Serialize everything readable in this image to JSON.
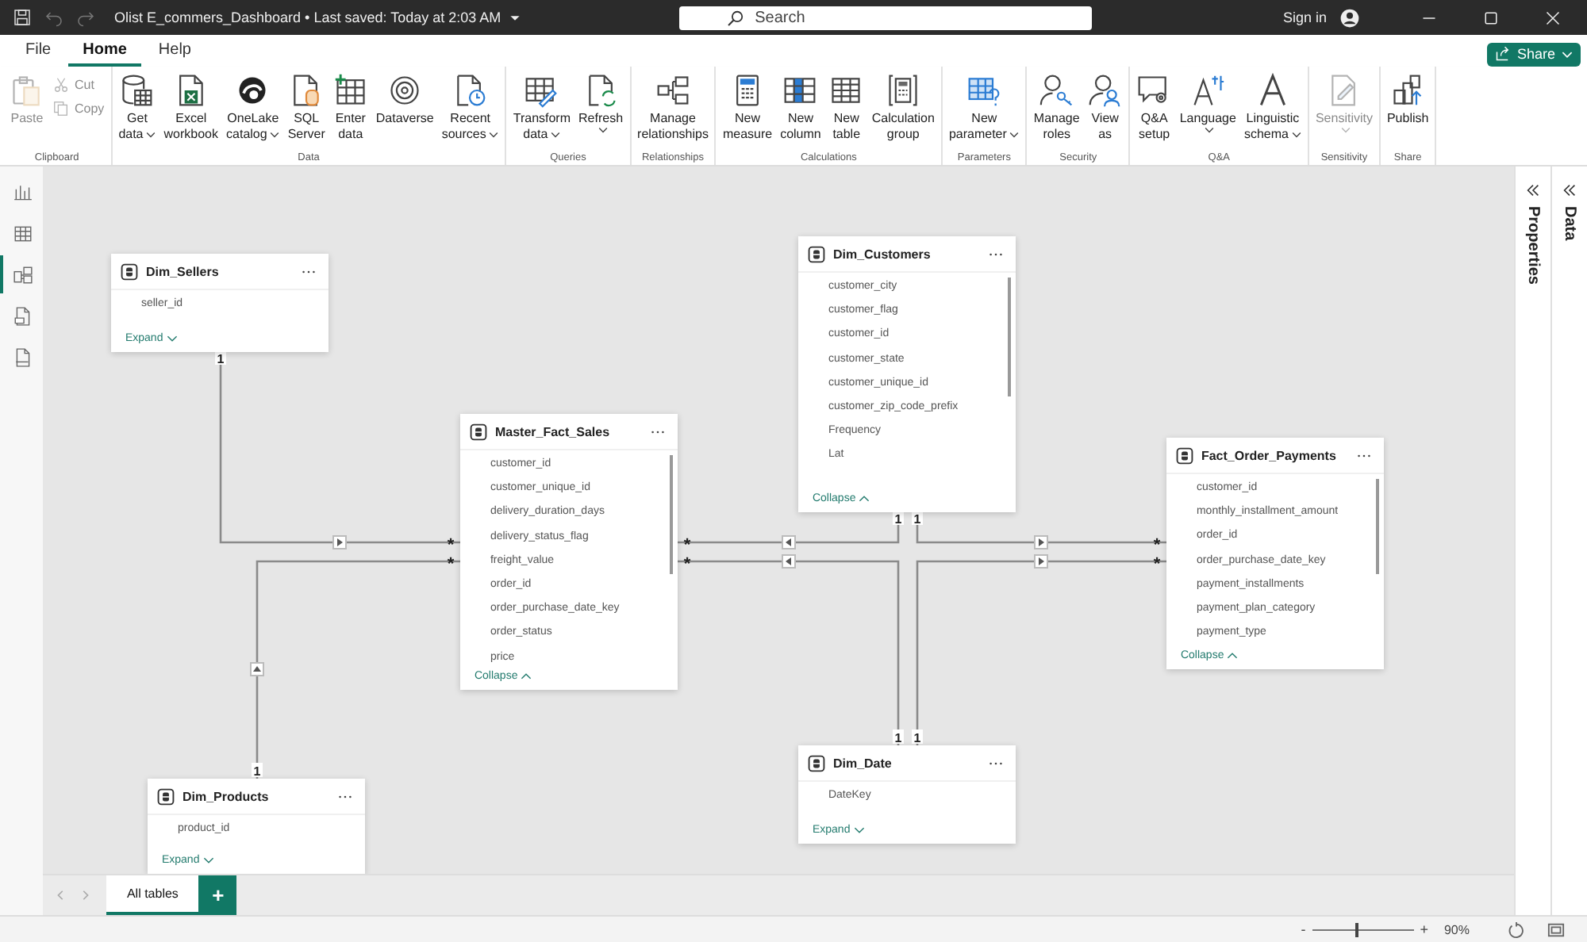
{
  "title_bar": {
    "document": "Olist E_commers_Dashboard • Last saved: Today at 2:03 AM",
    "search_placeholder": "Search",
    "sign_in": "Sign in"
  },
  "ribbon_tabs": [
    {
      "label": "File",
      "selected": false
    },
    {
      "label": "Home",
      "selected": true
    },
    {
      "label": "Help",
      "selected": false
    }
  ],
  "share": "Share",
  "ribbon_groups": [
    {
      "label": "Clipboard",
      "buttons": [
        {
          "kind": "large",
          "lines": [
            "Paste"
          ],
          "dropdown": false,
          "disabled": true
        },
        {
          "kind": "small",
          "lines": [
            "Cut"
          ],
          "disabled": true
        },
        {
          "kind": "small",
          "lines": [
            "Copy"
          ],
          "disabled": true
        }
      ]
    },
    {
      "label": "Data",
      "buttons": [
        {
          "kind": "large",
          "lines": [
            "Get",
            "data"
          ],
          "dropdown": true,
          "disabled": false
        },
        {
          "kind": "large",
          "lines": [
            "Excel",
            "workbook"
          ],
          "dropdown": false,
          "disabled": false
        },
        {
          "kind": "large",
          "lines": [
            "OneLake",
            "catalog"
          ],
          "dropdown": true,
          "disabled": false
        },
        {
          "kind": "large",
          "lines": [
            "SQL",
            "Server"
          ],
          "dropdown": false,
          "disabled": false
        },
        {
          "kind": "large",
          "lines": [
            "Enter",
            "data"
          ],
          "dropdown": false,
          "disabled": false
        },
        {
          "kind": "large",
          "lines": [
            "Dataverse"
          ],
          "dropdown": false,
          "disabled": false
        },
        {
          "kind": "large",
          "lines": [
            "Recent",
            "sources"
          ],
          "dropdown": true,
          "disabled": false
        }
      ]
    },
    {
      "label": "Queries",
      "buttons": [
        {
          "kind": "large",
          "lines": [
            "Transform",
            "data"
          ],
          "dropdown": true,
          "disabled": false
        },
        {
          "kind": "large",
          "lines": [
            "Refresh"
          ],
          "dropdown": true,
          "disabled": false
        }
      ]
    },
    {
      "label": "Relationships",
      "buttons": [
        {
          "kind": "large",
          "lines": [
            "Manage",
            "relationships"
          ],
          "dropdown": false,
          "disabled": false
        }
      ]
    },
    {
      "label": "Calculations",
      "buttons": [
        {
          "kind": "large",
          "lines": [
            "New",
            "measure"
          ],
          "dropdown": false,
          "disabled": false
        },
        {
          "kind": "large",
          "lines": [
            "New",
            "column"
          ],
          "dropdown": false,
          "disabled": false
        },
        {
          "kind": "large",
          "lines": [
            "New",
            "table"
          ],
          "dropdown": false,
          "disabled": false
        },
        {
          "kind": "large",
          "lines": [
            "Calculation",
            "group"
          ],
          "dropdown": false,
          "disabled": false
        }
      ]
    },
    {
      "label": "Parameters",
      "buttons": [
        {
          "kind": "large",
          "lines": [
            "New",
            "parameter"
          ],
          "dropdown": true,
          "disabled": false
        }
      ]
    },
    {
      "label": "Security",
      "buttons": [
        {
          "kind": "large",
          "lines": [
            "Manage",
            "roles"
          ],
          "dropdown": false,
          "disabled": false
        },
        {
          "kind": "large",
          "lines": [
            "View",
            "as"
          ],
          "dropdown": false,
          "disabled": false
        }
      ]
    },
    {
      "label": "Q&A",
      "buttons": [
        {
          "kind": "large",
          "lines": [
            "Q&A",
            "setup"
          ],
          "dropdown": false,
          "disabled": false
        },
        {
          "kind": "large",
          "lines": [
            "Language"
          ],
          "dropdown": true,
          "disabled": false
        },
        {
          "kind": "large",
          "lines": [
            "Linguistic",
            "schema"
          ],
          "dropdown": true,
          "disabled": false
        }
      ]
    },
    {
      "label": "Sensitivity",
      "buttons": [
        {
          "kind": "large",
          "lines": [
            "Sensitivity"
          ],
          "dropdown": true,
          "disabled": true
        }
      ]
    },
    {
      "label": "Share",
      "buttons": [
        {
          "kind": "large",
          "lines": [
            "Publish"
          ],
          "dropdown": false,
          "disabled": false
        }
      ]
    }
  ],
  "view_rail": [
    {
      "selected": false
    },
    {
      "selected": false
    },
    {
      "selected": true
    },
    {
      "selected": false
    },
    {
      "selected": false
    }
  ],
  "model_tables": [
    {
      "name": "Dim_Sellers",
      "fields": [
        "seller_id"
      ],
      "footer": "Expand",
      "expanded": false
    },
    {
      "name": "Master_Fact_Sales",
      "fields": [
        "customer_id",
        "customer_unique_id",
        "delivery_duration_days",
        "delivery_status_flag",
        "freight_value",
        "order_id",
        "order_purchase_date_key",
        "order_status",
        "price"
      ],
      "footer": "Collapse",
      "expanded": true
    },
    {
      "name": "Dim_Customers",
      "fields": [
        "customer_city",
        "customer_flag",
        "customer_id",
        "customer_state",
        "customer_unique_id",
        "customer_zip_code_prefix",
        "Frequency",
        "Lat"
      ],
      "footer": "Collapse",
      "expanded": true
    },
    {
      "name": "Fact_Order_Payments",
      "fields": [
        "customer_id",
        "monthly_installment_amount",
        "order_id",
        "order_purchase_date_key",
        "payment_installments",
        "payment_plan_category",
        "payment_type"
      ],
      "footer": "Collapse",
      "expanded": true
    },
    {
      "name": "Dim_Products",
      "fields": [
        "product_id"
      ],
      "footer": "Expand",
      "expanded": false
    },
    {
      "name": "Dim_Date",
      "fields": [
        "DateKey"
      ],
      "footer": "Expand",
      "expanded": false
    }
  ],
  "relationships": [
    {
      "one": "1",
      "many": "*",
      "kind": "right"
    },
    {
      "one": "1",
      "many": "*",
      "kind": "up"
    },
    {
      "one": "1",
      "many": "*",
      "kind": "left"
    },
    {
      "one": "1",
      "many": "*",
      "kind": "left"
    },
    {
      "one": "1",
      "many": "*",
      "kind": "right"
    },
    {
      "one": "1",
      "many": "*",
      "kind": "right"
    }
  ],
  "bottom_tabs": {
    "tabs": [
      {
        "label": "All tables",
        "selected": true
      }
    ],
    "add": "+"
  },
  "panes": [
    {
      "label": "Properties"
    },
    {
      "label": "Data"
    }
  ],
  "status_bar": {
    "zoom_out": "-",
    "zoom": {
      "level": 0.43
    },
    "zoom_in": "+",
    "zoom_reading": "90%"
  }
}
